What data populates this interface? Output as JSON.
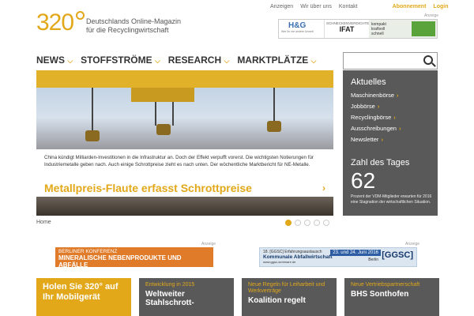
{
  "brand": {
    "logo_text": "320",
    "tagline_1": "Deutschlands Online-Magazin",
    "tagline_2": "für die Recyclingwirtschaft",
    "accent": "#e2a81a"
  },
  "topnav": {
    "anzeigen": "Anzeigen",
    "wir_ueber_uns": "Wir über uns",
    "kontakt": "Kontakt",
    "abonnement": "Abonnement",
    "login": "Login"
  },
  "ads": {
    "label": "Anzeige",
    "top": {
      "hg": "H&G",
      "hg_sub": "Wer Ihr nie andere Unwelt",
      "ifat_top": "SCHNECKENVERDICHTER",
      "ifat": "IFAT",
      "green": "kompakt kraftvoll schnell"
    },
    "left": {
      "line1": "BERLINER KONFERENZ",
      "line2": "MINERALISCHE NEBENPRODUKTE UND ABFÄLLE"
    },
    "right": {
      "line1": "18. [GGSC] Erfahrungsaustausch",
      "line2": "Kommunale Abfallwirtschaft",
      "date": "23. und 24. Juni 2016",
      "city": "Berlin",
      "url": "www.ggsc-seminare.de",
      "brand": "[GGSC]"
    }
  },
  "mainnav": [
    {
      "label": "NEWS"
    },
    {
      "label": "STOFFSTRÖME"
    },
    {
      "label": "RESEARCH"
    },
    {
      "label": "MARKTPLÄTZE"
    }
  ],
  "search": {
    "placeholder": ""
  },
  "hero": {
    "teaser": "China kündigt Milliarden-Investitionen in die Infrastruktur an. Doch der Effekt verpufft vorerst. Die wichtigsten Notierungen für Industriemetalle geben nach. Auch einige Schrottpreise zieht es nach unten. Der wöchentliche Marktbericht für NE-Metalle.",
    "title": "Metallpreis-Flaute erfasst Schrottpreise",
    "arrow": "›"
  },
  "aside": {
    "aktuelles_title": "Aktuelles",
    "links": [
      "Maschinenbörse",
      "Jobbörse",
      "Recyclingbörse",
      "Ausschreibungen",
      "Newsletter"
    ],
    "arrow": "›",
    "zahl_title": "Zahl des Tages",
    "zahl_value": "62",
    "zahl_text": "Prozent der VDM-Mitglieder erwarten für 2016 eine Stagnation der wirtschaftlichen Situation."
  },
  "breadcrumb": "Home",
  "pager": {
    "count": 5,
    "active": 1
  },
  "tiles": [
    {
      "kicker": "",
      "title": "Holen Sie 320° auf Ihr Mobilgerät"
    },
    {
      "kicker": "Entwicklung in 2015",
      "title": "Weltweiter Stahlschrott-"
    },
    {
      "kicker": "Neue Regeln für Leiharbeit und Werkverträge",
      "title": "Koalition regelt"
    },
    {
      "kicker": "Neue Vertriebspartnerschaft",
      "title": "BHS Sonthofen"
    }
  ]
}
